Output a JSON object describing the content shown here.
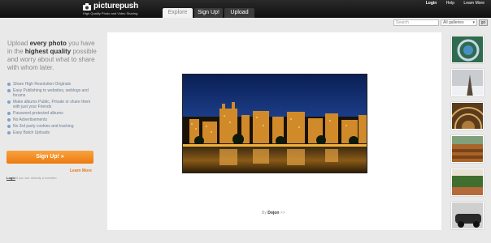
{
  "header": {
    "logo_name": "picturepush",
    "tagline": "High Quality Photo and Video Sharing",
    "tabs": [
      {
        "label": "Explore",
        "active": true
      },
      {
        "label": "Sign Up!",
        "active": false
      },
      {
        "label": "Upload",
        "active": false
      }
    ],
    "links": {
      "login": "Login",
      "help": "Help",
      "learn_more": "Learn More"
    }
  },
  "search": {
    "placeholder": "Search",
    "scope": "All galleries",
    "go_label": "go"
  },
  "promo": {
    "pre1": "Upload ",
    "bold1": "every photo",
    "mid1": " you have in the ",
    "bold2": "highest quality",
    "post1": " possible and worry about what to share with whom later."
  },
  "features": [
    "Share High Resolution Originals",
    "Easy Publishing to websites, weblogs and forums",
    "Make albums Public, Private or share them with just your Friends",
    "Password protected albums",
    "No Advertisements",
    "No 3rd party cookies and tracking",
    "Easy Batch Uploads"
  ],
  "cta": {
    "signup_label": "Sign Up! »",
    "learn_more": "Learn More",
    "login_label": "Login",
    "login_suffix": " if you are already a member"
  },
  "photo": {
    "credit_prefix": "By ",
    "author": "Dojon",
    "credit_suffix": " >>"
  },
  "colors": {
    "header_bg": "#111111",
    "accent_orange": "#ef8520",
    "link_blue": "#6a7d95",
    "page_bg": "#e9e9e9"
  },
  "icons": [
    "logo-camera-icon",
    "bullet-icon"
  ]
}
